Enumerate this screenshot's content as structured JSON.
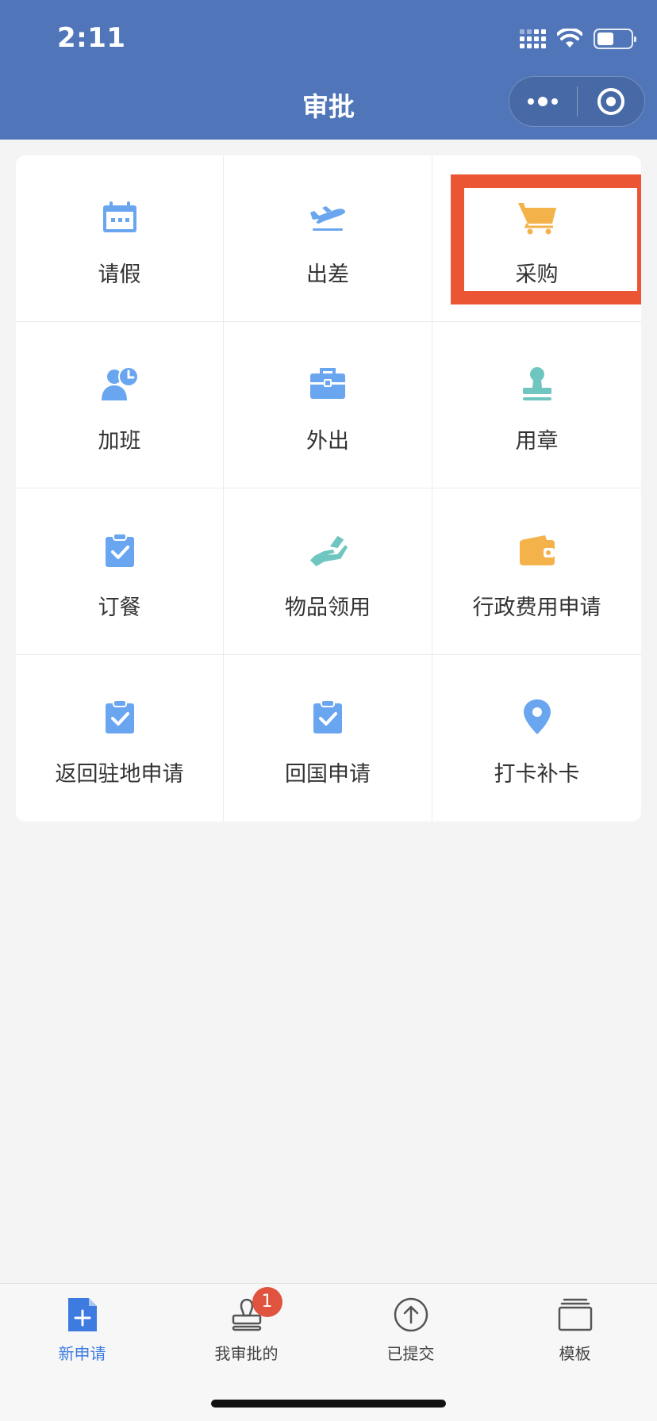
{
  "status_bar": {
    "time": "2:11",
    "battery_level": 0.45
  },
  "nav": {
    "title": "审批"
  },
  "grid": {
    "items": [
      {
        "label": "请假",
        "icon": "calendar-icon",
        "color": "#6aa6f0"
      },
      {
        "label": "出差",
        "icon": "airplane-icon",
        "color": "#6aa6f0"
      },
      {
        "label": "采购",
        "icon": "shopping-cart-icon",
        "color": "#f4b24a",
        "highlighted": true
      },
      {
        "label": "加班",
        "icon": "user-clock-icon",
        "color": "#6aa6f0"
      },
      {
        "label": "外出",
        "icon": "briefcase-icon",
        "color": "#6aa6f0"
      },
      {
        "label": "用章",
        "icon": "stamp-icon",
        "color": "#6fc6c0"
      },
      {
        "label": "订餐",
        "icon": "clipboard-check-icon",
        "color": "#6aa6f0"
      },
      {
        "label": "物品领用",
        "icon": "hand-receive-icon",
        "color": "#6fc6c0"
      },
      {
        "label": "行政费用申请",
        "icon": "wallet-icon",
        "color": "#f4b24a"
      },
      {
        "label": "返回驻地申请",
        "icon": "clipboard-check-icon",
        "color": "#6aa6f0"
      },
      {
        "label": "回国申请",
        "icon": "clipboard-check-icon",
        "color": "#6aa6f0"
      },
      {
        "label": "打卡补卡",
        "icon": "location-pin-icon",
        "color": "#6aa6f0"
      }
    ],
    "highlight_color": "#ec5533"
  },
  "tabbar": {
    "tabs": [
      {
        "label": "新申请",
        "icon": "new-document-icon",
        "active": true
      },
      {
        "label": "我审批的",
        "icon": "stamp-outline-icon",
        "badge": "1"
      },
      {
        "label": "已提交",
        "icon": "upload-circle-icon"
      },
      {
        "label": "模板",
        "icon": "template-stack-icon"
      }
    ],
    "accent_color": "#3d7be0"
  }
}
